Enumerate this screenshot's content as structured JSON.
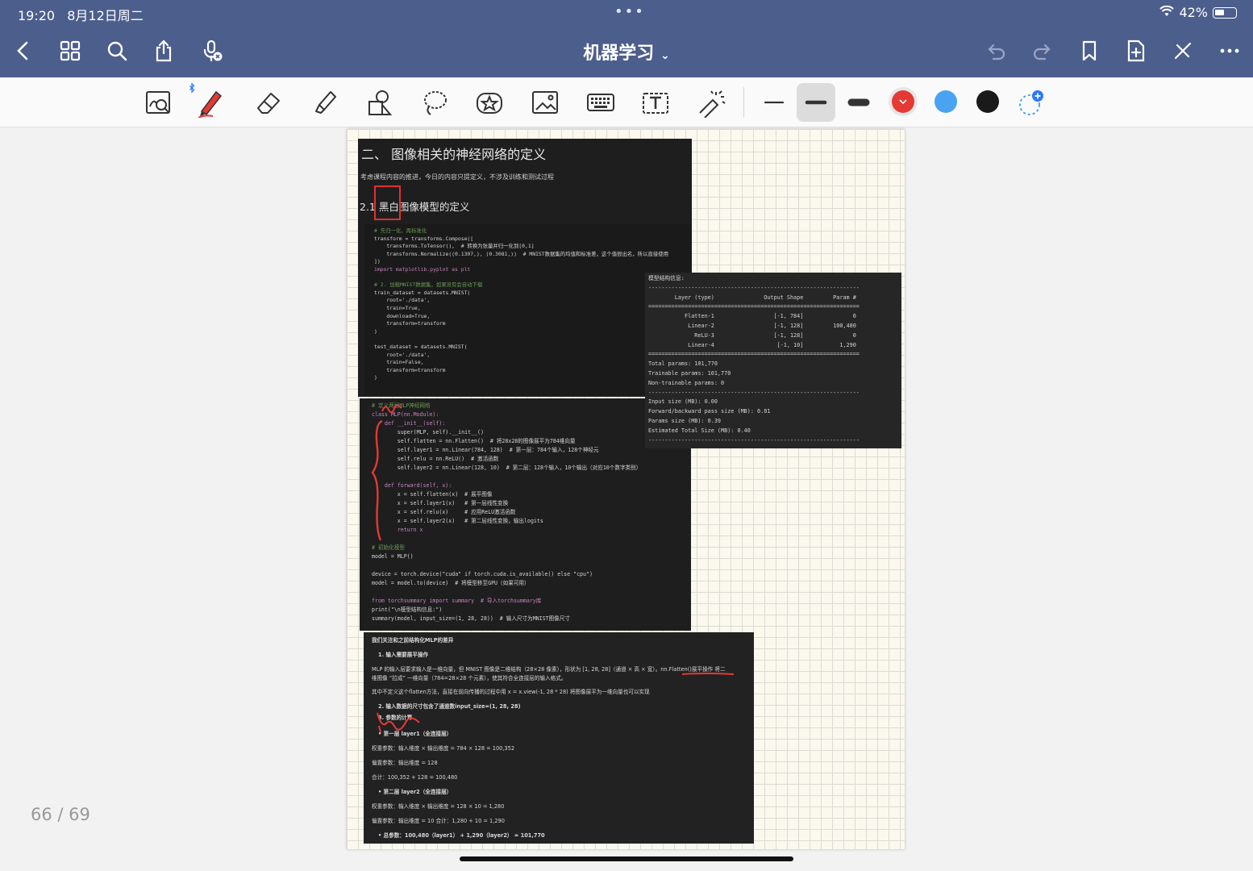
{
  "status": {
    "time": "19:20",
    "date": "8月12日周二",
    "battery": "42%"
  },
  "nav": {
    "title": "机器学习"
  },
  "colors": {
    "nav_bg": "#4c5e8c",
    "red": "#e53935",
    "blue": "#4aa3f0",
    "black": "#1a1a1a"
  },
  "footer": {
    "page_counter": "66 / 69"
  },
  "doc": {
    "heading": "二、 图像相关的神经网络的定义",
    "note": "考虑课程内容的推进，今日的内容只提定义，不涉及训练和测试过程",
    "subheading": "2.1 黑白图像模型的定义",
    "code1": [
      "# 先归一化，再标准化",
      "transform = transforms.Compose([",
      "    transforms.ToTensor(),  # 转换为张量并归一化到[0,1]",
      "    transforms.Normalize((0.1307,), (0.3081,))  # MNIST数据集的均值和标准差，这个值很出名，所以直接使用",
      "])",
      "import matplotlib.pyplot as plt",
      "",
      "# 2. 加载MNIST数据集，如果没有会自动下载",
      "train_dataset = datasets.MNIST(",
      "    root='./data',",
      "    train=True,",
      "    download=True,",
      "    transform=transform",
      ")",
      "",
      "test_dataset = datasets.MNIST(",
      "    root='./data',",
      "    train=False,",
      "    transform=transform",
      ")"
    ],
    "code2": [
      "# 定义两层MLP神经网络",
      "class MLP(nn.Module):",
      "    def __init__(self):",
      "        super(MLP, self).__init__()",
      "        self.flatten = nn.Flatten()  # 将28x28的图像展平为784维向量",
      "        self.layer1 = nn.Linear(784, 128)  # 第一层：784个输入，128个神经元",
      "        self.relu = nn.ReLU()  # 激活函数",
      "        self.layer2 = nn.Linear(128, 10)  # 第二层：128个输入，10个输出（对应10个数字类别）",
      "",
      "    def forward(self, x):",
      "        x = self.flatten(x)  # 展平图像",
      "        x = self.layer1(x)   # 第一层线性变换",
      "        x = self.relu(x)     # 应用ReLU激活函数",
      "        x = self.layer2(x)   # 第二层线性变换，输出logits",
      "        return x",
      "",
      "# 初始化模型",
      "model = MLP()",
      "",
      "device = torch.device(\"cuda\" if torch.cuda.is_available() else \"cpu\")",
      "model = model.to(device)  # 将模型移至GPU（如果可用）",
      "",
      "from torchsummary import summary  # 导入torchsummary库",
      "print(\"\\n模型结构信息:\")",
      "summary(model, input_size=(1, 28, 28))  # 输入尺寸为MNIST图像尺寸"
    ],
    "summary_out": [
      "模型结构信息:",
      "----------------------------------------------------------------",
      "        Layer (type)               Output Shape         Param #",
      "================================================================",
      "           Flatten-1                  [-1, 784]               0",
      "            Linear-2                  [-1, 128]         100,480",
      "              ReLU-3                  [-1, 128]               0",
      "            Linear-4                   [-1, 10]           1,290",
      "================================================================",
      "Total params: 101,770",
      "Trainable params: 101,770",
      "Non-trainable params: 0",
      "----------------------------------------------------------------",
      "Input size (MB): 0.00",
      "Forward/backward pass size (MB): 0.01",
      "Params size (MB): 0.39",
      "Estimated Total Size (MB): 0.40",
      "----------------------------------------------------------------"
    ],
    "notes": [
      "我们关注和之前结构化MLP的差异",
      "1. 输入需要展平操作",
      "MLP 的输入层要求输入是一维向量，但 MNIST 图像是二维结构（28×28 像素），形状为 [1, 28, 28]（通道 × 高 × 宽）。nn.Flatten()展平操作 将二",
      "维图像 “拉成” 一维向量（784=28×28 个元素），使其符合全连接层的输入格式。",
      "其中不定义这个flatten方法，直接在前向传播的过程中用 x = x.view(-1, 28 * 28) 将图像展平为一维向量也可以实现",
      "2. 输入数据的尺寸包含了通道数input_size=(1, 28, 28)",
      "3. 参数的计算",
      "• 第一层 layer1（全连接层）",
      "权重参数：输入维度 × 输出维度 = 784 × 128 = 100,352",
      "偏置参数：输出维度 = 128",
      "合计：100,352 + 128 = 100,480",
      "• 第二层 layer2（全连接层）",
      "权重参数：输入维度 × 输出维度 = 128 × 10 = 1,280",
      "偏置参数：输出维度 = 10 合计：1,280 + 10 = 1,290",
      "• 总参数：100,480（layer1） + 1,290（layer2） = 101,770"
    ]
  }
}
